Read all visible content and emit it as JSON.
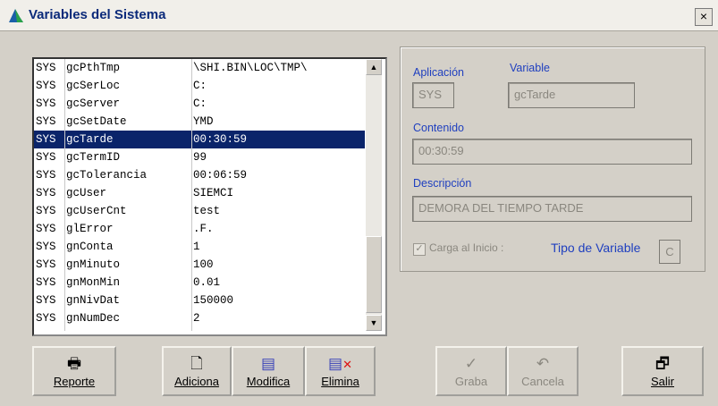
{
  "window": {
    "title": "Variables del Sistema",
    "close_glyph": "×"
  },
  "list": {
    "rows": [
      [
        "SYS",
        "gcPthTmp",
        "\\SHI.BIN\\LOC\\TMP\\"
      ],
      [
        "SYS",
        "gcSerLoc",
        "C:"
      ],
      [
        "SYS",
        "gcServer",
        "C:"
      ],
      [
        "SYS",
        "gcSetDate",
        "YMD"
      ],
      [
        "SYS",
        "gcTarde",
        "00:30:59"
      ],
      [
        "SYS",
        "gcTermID",
        "99"
      ],
      [
        "SYS",
        "gcTolerancia",
        "00:06:59"
      ],
      [
        "SYS",
        "gcUser",
        "SIEMCI"
      ],
      [
        "SYS",
        "gcUserCnt",
        "test"
      ],
      [
        "SYS",
        "glError",
        ".F."
      ],
      [
        "SYS",
        "gnConta",
        "1"
      ],
      [
        "SYS",
        "gnMinuto",
        "100"
      ],
      [
        "SYS",
        "gnMonMin",
        "0.01"
      ],
      [
        "SYS",
        "gnNivDat",
        "150000"
      ],
      [
        "SYS",
        "gnNumDec",
        "2"
      ]
    ],
    "selected_index": 4
  },
  "detail": {
    "aplicacion_label": "Aplicación",
    "aplicacion_value": "SYS",
    "variable_label": "Variable",
    "variable_value": "gcTarde",
    "contenido_label": "Contenido",
    "contenido_value": "00:30:59",
    "descripcion_label": "Descripción",
    "descripcion_value": "DEMORA DEL TIEMPO TARDE",
    "carga_label": "Carga al Inicio :",
    "carga_checked": true,
    "tipo_label": "Tipo de Variable",
    "tipo_value": "C"
  },
  "buttons": {
    "reporte": "Reporte",
    "adiciona": "Adiciona",
    "modifica": "Modifica",
    "elimina": "Elimina",
    "graba": "Graba",
    "cancela": "Cancela",
    "salir": "Salir"
  },
  "icons": {
    "printer": "printer-icon",
    "new_doc": "new-document-icon",
    "edit_doc": "edit-document-icon",
    "delete_doc": "delete-document-icon",
    "check": "checkmark-icon",
    "undo": "undo-icon",
    "exit": "exit-door-icon"
  },
  "colors": {
    "selection": "#0a246a",
    "label_blue": "#1f3fbf",
    "disabled": "#8a877f"
  }
}
